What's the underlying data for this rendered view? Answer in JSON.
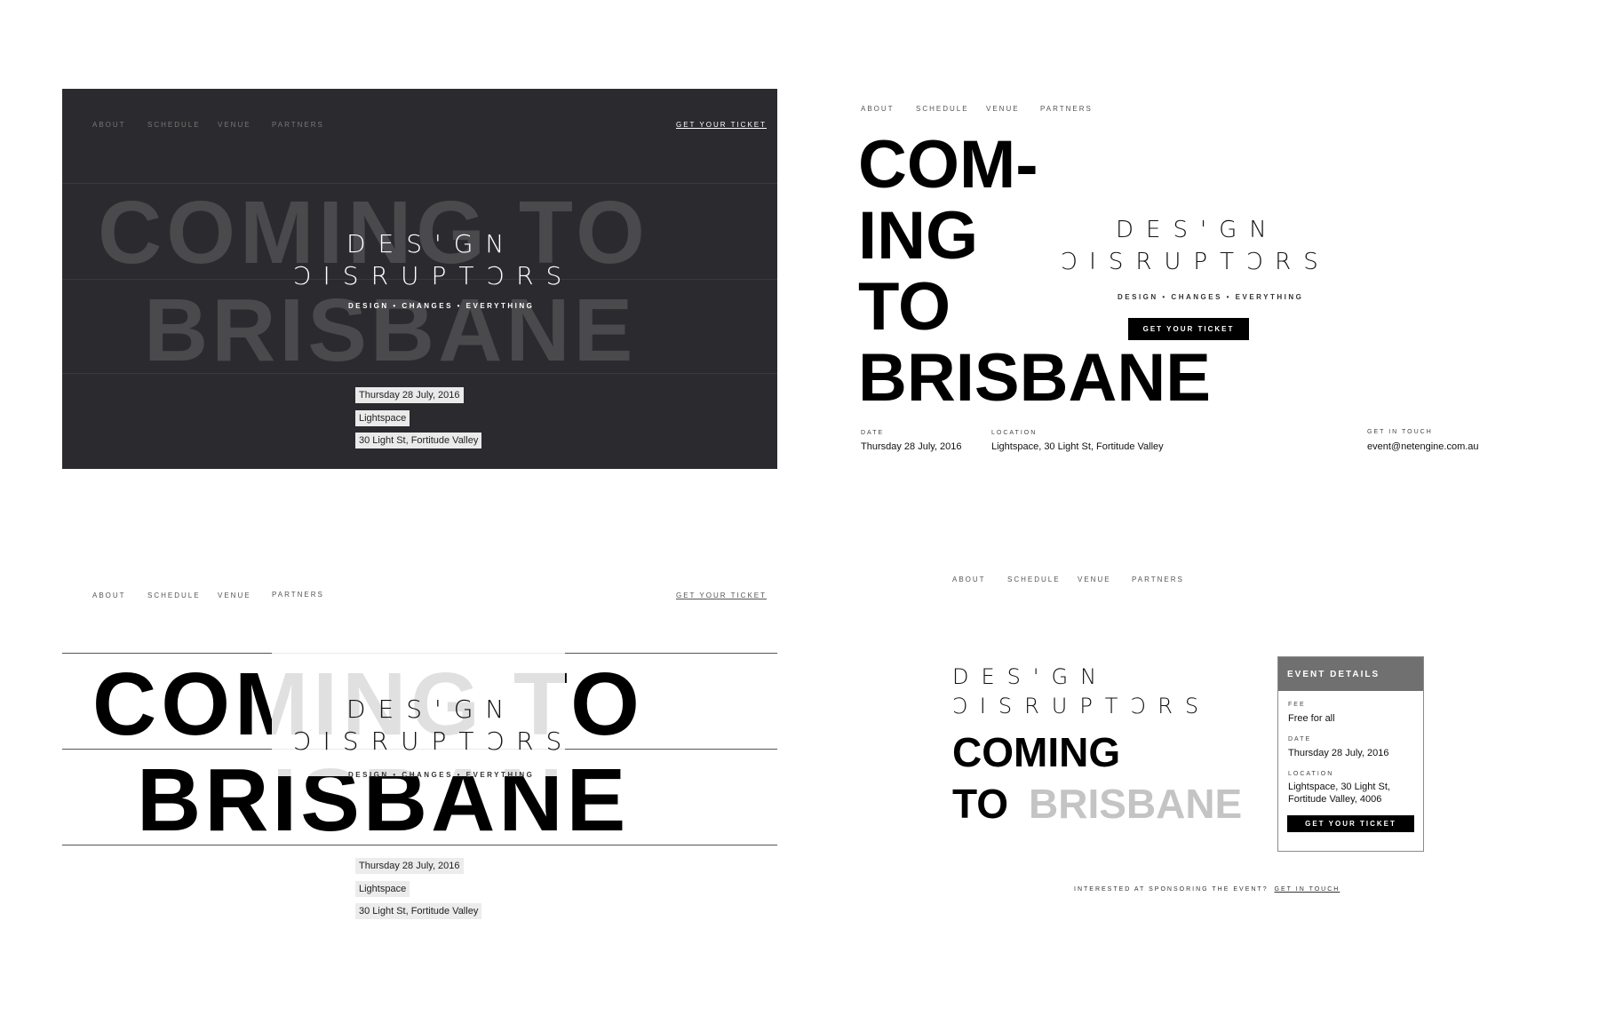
{
  "nav": {
    "about": "ABOUT",
    "schedule": "SCHEDULE",
    "venue": "VENUE",
    "partners": "PARTNERS",
    "ticket_link": "GET YOUR TICKET"
  },
  "headline": {
    "line1": "COMING TO",
    "line2": "BRISBANE",
    "split1": "COM-",
    "split2": "ING",
    "split3": "TO",
    "split4": "BRISBANE",
    "coming": "COMING",
    "to": "TO",
    "brisbane": "BRISBANE"
  },
  "logo": {
    "line1": "DΕS'GΝ",
    "line2": "ϽΙSRUPTϽRS",
    "tagline": "DESIGN • CHANGES • EVERYTHING"
  },
  "event": {
    "date": "Thursday 28 July, 2016",
    "venue": "Lightspace",
    "address": "30 Light St, Fortitude Valley",
    "location_full": "Lightspace, 30 Light St, Fortitude Valley",
    "email": "event@netengine.com.au",
    "fee": "Free for all",
    "location_line1": "Lightspace, 30 Light St,",
    "location_line2": "Fortitude Valley, 4006"
  },
  "labels": {
    "date": "DATE",
    "location": "LOCATION",
    "get_in_touch": "GET IN TOUCH",
    "fee": "FEE",
    "event_details": "EVENT DETAILS",
    "get_your_ticket": "GET YOUR TICKET"
  },
  "footer": {
    "sponsor_text": "INTERESTED AT SPONSORING THE EVENT?",
    "sponsor_link": "GET IN TOUCH"
  },
  "colors": {
    "dark_bg": "#2b2b2f",
    "ghost_dark": "#4a4a4d",
    "ghost_light": "#e6e6e6",
    "muted": "#c4c4c4",
    "panel_header": "#707070"
  }
}
